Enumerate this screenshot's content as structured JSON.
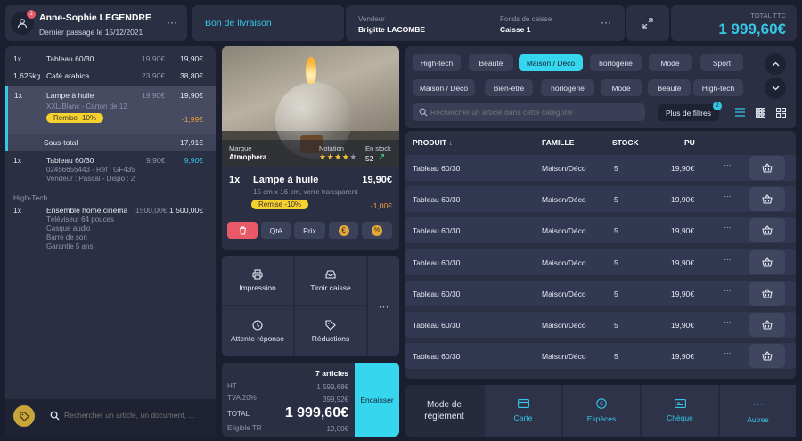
{
  "customer": {
    "name": "Anne-Sophie LEGENDRE",
    "last_visit": "Dernier passage le 15/12/2021",
    "notif_count": "1"
  },
  "header": {
    "delivery_label": "Bon de livraison",
    "seller_label": "Vendeur",
    "seller_value": "Brigitte LACOMBE",
    "cash_label": "Fonds de caisse",
    "cash_value": "Caisse 1",
    "total_label": "TOTAL TTC",
    "total_value": "1 999,60€"
  },
  "cart": {
    "lines": [
      {
        "qty": "1x",
        "name": "Tableau 60/30",
        "unit": "19,90€",
        "total": "19,90€"
      },
      {
        "qty": "1,625kg",
        "name": "Café arabica",
        "unit": "23,90€",
        "total": "38,80€"
      },
      {
        "qty": "1x",
        "name": "Lampe à huile",
        "unit": "19,90€",
        "total": "19,90€",
        "sub": "XXL/Blanc - Carton de 12",
        "discount": "Remise -10%",
        "discount_value": "-1,99€"
      },
      {
        "qty": "1x",
        "name": "Tableau 60/30",
        "unit": "9,90€",
        "total": "9,90€",
        "sub1": "02456655443 - Réf : GF435",
        "sub2": "Vendeur : Pascal - Dispo : 2"
      },
      {
        "qty": "1x",
        "name": "Ensemble home cinéma",
        "unit": "1500,00€",
        "total": "1 500,00€",
        "sub1": "Téléviseur 64 pouces",
        "sub2": "Casque audio",
        "sub3": "Barre de son",
        "sub4": "Garantie 5 ans"
      }
    ],
    "subtotal_label": "Sous-total",
    "subtotal_value": "17,91€",
    "group_label": "High-Tech",
    "search_placeholder": "Rechercher un article, un document, ..."
  },
  "product": {
    "brand_label": "Marque",
    "brand_value": "Atmophera",
    "rating_label": "Notation",
    "rating": 4,
    "stock_label": "En stock",
    "stock_value": "52",
    "qty": "1x",
    "name": "Lampe à huile",
    "price": "19,90€",
    "desc": "15 cm x 16 cm, verre transparent",
    "discount": "Remise -10%",
    "discount_value": "-1,00€",
    "btn_qty": "Qté",
    "btn_price": "Prix"
  },
  "actions": {
    "print": "Impression",
    "drawer": "Tiroir caisse",
    "hold": "Attente réponse",
    "discounts": "Réductions"
  },
  "summary": {
    "articles": "7 articles",
    "ht_label": "HT",
    "ht_value": "1 599,68€",
    "tva_label": "TVA 20%",
    "tva_value": "399,92€",
    "total_label": "TOTAL",
    "total_value": "1 999,60€",
    "tr_label": "Eligible TR",
    "tr_value": "19,00€",
    "cash_button": "Encaisser"
  },
  "categories": {
    "row1": [
      "High-tech",
      "Beauté",
      "Maison / Déco",
      "horlogerie",
      "Mode",
      "Sport"
    ],
    "row2": [
      "Maison / Déco",
      "Bien-être",
      "horlogerie",
      "Mode",
      "Beauté",
      "High-tech"
    ],
    "active": "Maison / Déco",
    "search_placeholder": "Rechercher un article dans cette catégorie",
    "filters_label": "Plus de filtres",
    "filters_count": "2"
  },
  "table": {
    "headers": {
      "product": "PRODUIT",
      "family": "FAMILLE",
      "stock": "STOCK",
      "pu": "PU"
    },
    "rows": [
      {
        "product": "Tableau 60/30",
        "family": "Maison/Déco",
        "stock": "5",
        "pu": "19,90€"
      },
      {
        "product": "Tableau 60/30",
        "family": "Maison/Déco",
        "stock": "5",
        "pu": "19,90€"
      },
      {
        "product": "Tableau 60/30",
        "family": "Maison/Déco",
        "stock": "5",
        "pu": "19,90€"
      },
      {
        "product": "Tableau 60/30",
        "family": "Maison/Déco",
        "stock": "5",
        "pu": "19,90€"
      },
      {
        "product": "Tableau 60/30",
        "family": "Maison/Déco",
        "stock": "5",
        "pu": "19,90€"
      },
      {
        "product": "Tableau 60/30",
        "family": "Maison/Déco",
        "stock": "5",
        "pu": "19,90€"
      },
      {
        "product": "Tableau 60/30",
        "family": "Maison/Déco",
        "stock": "5",
        "pu": "19,90€"
      }
    ]
  },
  "payment": {
    "label1": "Mode de",
    "label2": "règlement",
    "card": "Carte",
    "cash": "Espèces",
    "check": "Chèque",
    "other": "Autres"
  },
  "colors": {
    "accent": "#35c7e6",
    "active_chip": "#35d6ee",
    "discount": "#f7d22e",
    "delete": "#e85a68",
    "orange": "#f0a43a",
    "panel": "#2b2f44",
    "background": "#1b1e2e"
  }
}
